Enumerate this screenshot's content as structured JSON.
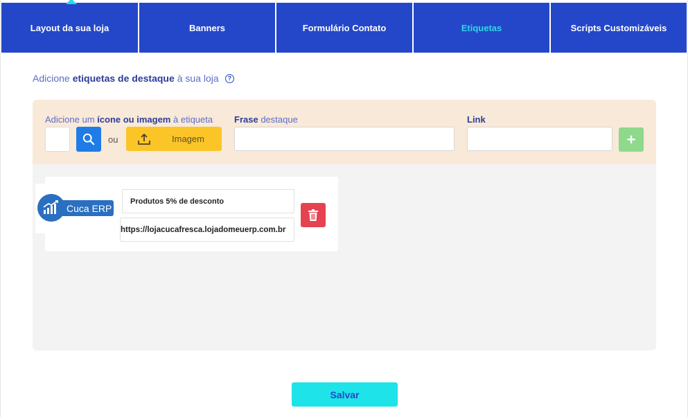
{
  "tabs": [
    {
      "label": "Layout da sua loja",
      "active": false
    },
    {
      "label": "Banners",
      "active": false
    },
    {
      "label": "Formulário Contato",
      "active": false
    },
    {
      "label": "Etiquetas",
      "active": true
    },
    {
      "label": "Scripts Customizáveis",
      "active": false
    }
  ],
  "intro": {
    "prefix": "Adicione",
    "bold": "etiquetas de destaque",
    "suffix": "à sua loja",
    "help_icon": "question-circle-icon"
  },
  "form": {
    "icon_label_prefix": "Adicione um",
    "icon_label_bold": "ícone ou imagem",
    "icon_label_suffix": "à etiqueta",
    "or_text": "ou",
    "image_button": "Imagem",
    "phrase_label_bold": "Frase",
    "phrase_label_suffix": "destaque",
    "link_label": "Link",
    "add_icon": "plus-icon",
    "search_icon": "search-icon",
    "upload_icon": "upload-icon"
  },
  "labels_list": [
    {
      "logo_text": "Cuca ERP",
      "phrase": "Produtos 5% de desconto",
      "link": "https://lojacucafresca.lojadomeuerp.com.br",
      "delete_icon": "trash-icon"
    }
  ],
  "save_button": "Salvar",
  "colors": {
    "tab_bg": "#2447c9",
    "tab_active_text": "#2fd6e8",
    "search_btn": "#1f7ce6",
    "image_btn": "#fbc527",
    "add_btn": "#8ed98c",
    "delete_btn": "#e5434f",
    "save_btn": "#1ee3e8",
    "panel_top": "#f9e9d8"
  }
}
